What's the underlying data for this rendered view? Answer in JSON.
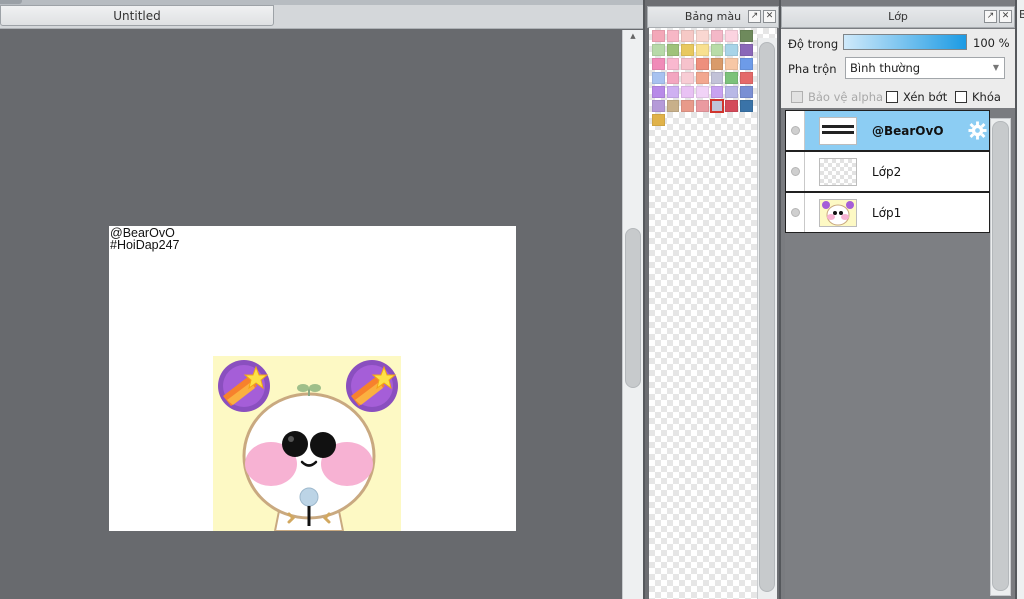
{
  "document": {
    "tab_title": "Untitled",
    "credits": [
      "@BearOvO",
      "#HoiDap247"
    ]
  },
  "palette": {
    "title": "Bảng màu",
    "swatches": [
      "#f3a7b8",
      "#f7b7c6",
      "#f6c9c6",
      "#f9d7d1",
      "#f4b8c8",
      "#fbd3e0",
      "#6e8a5c",
      "#b7d9a8",
      "#9fc27a",
      "#e8c85f",
      "#f8e090",
      "#b8dca8",
      "#a8d4e8",
      "#8a68b8",
      "#f08bb8",
      "#f9b8cf",
      "#f6c2cc",
      "#ee8f7d",
      "#d99b6a",
      "#f7c7a5",
      "#6d9be8",
      "#a8c2f0",
      "#f3a6c0",
      "#f8cdd5",
      "#f2a78f",
      "#c2c2d8",
      "#7cc27a",
      "#e46a6a",
      "#b88ae8",
      "#cfb0f2",
      "#e9c2f4",
      "#f1d3f7",
      "#c8a2f0",
      "#b8b8e6",
      "#7a8fd4",
      "#b59ad8",
      "#c8b08a",
      "#e89a8a",
      "#ea9aa0",
      "#c0c4d8",
      "#d44a5a",
      "#3a73a8",
      "#e0b24a"
    ],
    "selected_index": 39
  },
  "layers_panel": {
    "title": "Lớp",
    "opacity_label": "Độ trong",
    "opacity_value": "100 %",
    "opacity": 1.0,
    "blend_label": "Pha trộn",
    "blend_value": "Bình thường",
    "protect_alpha": "Bảo vệ alpha",
    "clipping": "Xén bớt",
    "lock": "Khóa",
    "layers": [
      {
        "name": "@BearOvO",
        "active": true
      },
      {
        "name": "Lớp2",
        "active": false
      },
      {
        "name": "Lớp1",
        "active": false
      }
    ]
  },
  "right_panel": {
    "title_fragment": "B"
  }
}
